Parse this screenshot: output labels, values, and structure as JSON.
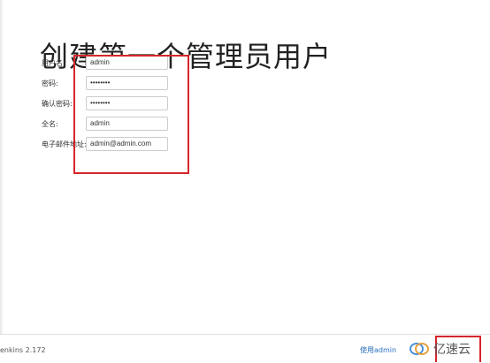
{
  "page": {
    "title": "创建第一个管理员用户"
  },
  "form": {
    "fields": [
      {
        "label": "用户名:",
        "value": "admin",
        "type": "text"
      },
      {
        "label": "密码:",
        "value": "••••••••",
        "type": "password"
      },
      {
        "label": "确认密码:",
        "value": "••••••••",
        "type": "password"
      },
      {
        "label": "全名:",
        "value": "admin",
        "type": "text"
      },
      {
        "label": "电子邮件地址:",
        "value": "admin@admin.com",
        "type": "text"
      }
    ]
  },
  "footer": {
    "version": "enkins 2.172",
    "use_admin_link": "使用admin"
  },
  "watermark": {
    "text": "亿速云",
    "icon": "yisu-cloud-logo"
  },
  "colors": {
    "highlight": "#d6262b",
    "link": "#2a6fbd"
  }
}
